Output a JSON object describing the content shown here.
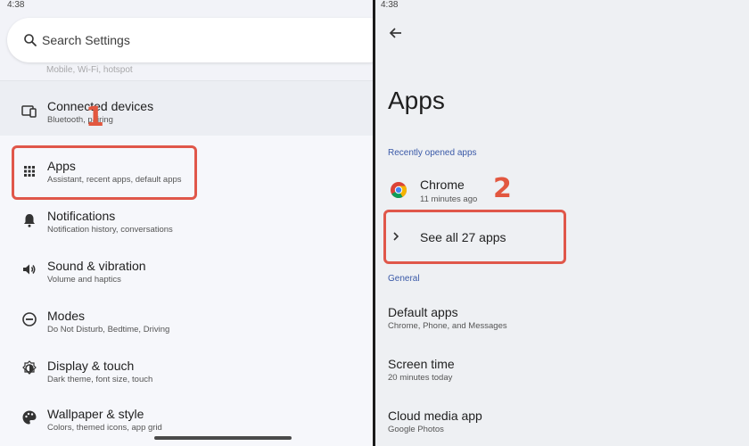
{
  "left": {
    "status_time": "4:38",
    "search": {
      "placeholder": "Search Settings"
    },
    "peek_text": "Mobile, Wi-Fi, hotspot",
    "items": [
      {
        "title": "Connected devices",
        "subtitle": "Bluetooth, pairing",
        "icon": "devices-icon"
      },
      {
        "title": "Apps",
        "subtitle": "Assistant, recent apps, default apps",
        "icon": "apps-grid-icon"
      },
      {
        "title": "Notifications",
        "subtitle": "Notification history, conversations",
        "icon": "bell-icon"
      },
      {
        "title": "Sound & vibration",
        "subtitle": "Volume and haptics",
        "icon": "speaker-icon"
      },
      {
        "title": "Modes",
        "subtitle": "Do Not Disturb, Bedtime, Driving",
        "icon": "modes-icon"
      },
      {
        "title": "Display & touch",
        "subtitle": "Dark theme, font size, touch",
        "icon": "display-icon"
      },
      {
        "title": "Wallpaper & style",
        "subtitle": "Colors, themed icons, app grid",
        "icon": "palette-icon"
      }
    ],
    "step_label": "1"
  },
  "right": {
    "status_time": "4:38",
    "title": "Apps",
    "recent_label": "Recently opened apps",
    "recent_app": {
      "name": "Chrome",
      "time": "11 minutes ago",
      "icon": "chrome-icon"
    },
    "see_all": "See all 27 apps",
    "general_label": "General",
    "items": [
      {
        "title": "Default apps",
        "subtitle": "Chrome, Phone, and Messages"
      },
      {
        "title": "Screen time",
        "subtitle": "20 minutes today"
      },
      {
        "title": "Cloud media app",
        "subtitle": "Google Photos"
      }
    ],
    "step_label": "2"
  },
  "colors": {
    "highlight": "#e0574a",
    "section_label": "#3b5aa8"
  }
}
